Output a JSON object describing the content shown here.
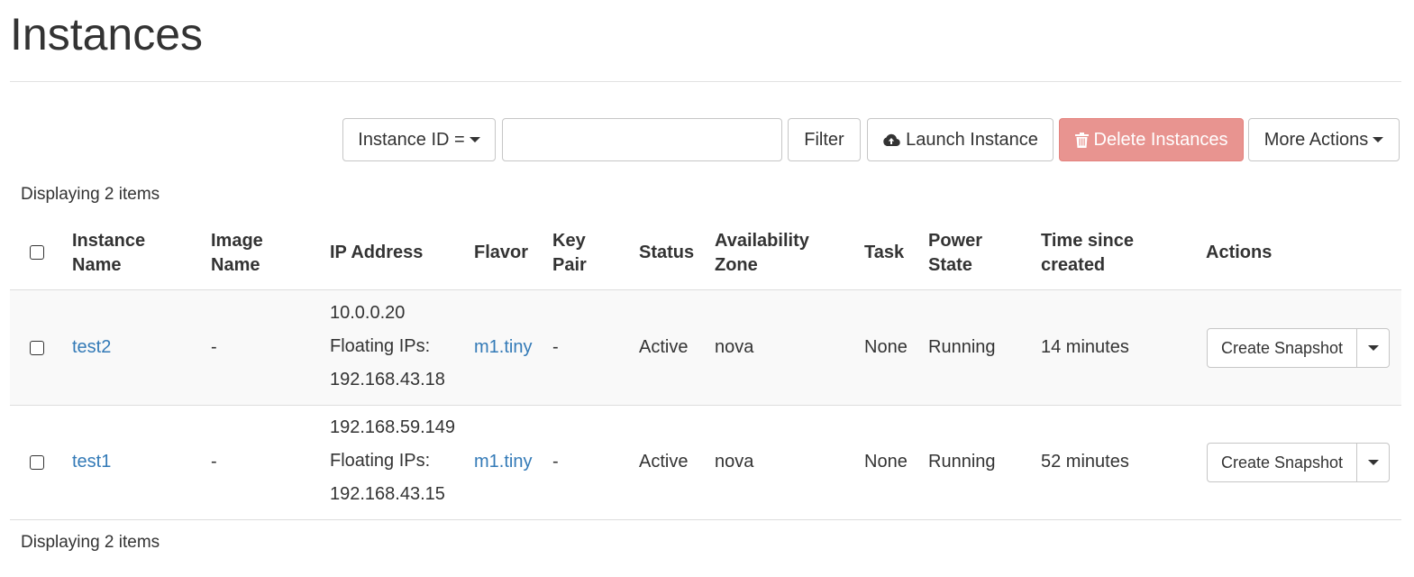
{
  "page": {
    "title": "Instances"
  },
  "toolbar": {
    "filter_field": "Instance ID =",
    "filter_value": "",
    "filter_label": "Filter",
    "launch_label": "Launch Instance",
    "delete_label": "Delete Instances",
    "more_label": "More Actions"
  },
  "summary": {
    "top": "Displaying 2 items",
    "bottom": "Displaying 2 items"
  },
  "table": {
    "headers": {
      "name": [
        "Instance",
        "Name"
      ],
      "image": [
        "Image",
        "Name"
      ],
      "ip": [
        "IP Address"
      ],
      "flavor": [
        "Flavor"
      ],
      "key": [
        "Key",
        "Pair"
      ],
      "status": [
        "Status"
      ],
      "zone": [
        "Availability",
        "Zone"
      ],
      "task": [
        "Task"
      ],
      "power": [
        "Power",
        "State"
      ],
      "time": [
        "Time since",
        "created"
      ],
      "actions": [
        "Actions"
      ]
    },
    "rows": [
      {
        "name": "test2",
        "image": "-",
        "ip": [
          "10.0.0.20",
          "Floating IPs:",
          "192.168.43.18"
        ],
        "flavor": "m1.tiny",
        "key_pair": "-",
        "status": "Active",
        "zone": "nova",
        "task": "None",
        "power_state": "Running",
        "age": "14 minutes",
        "action_label": "Create Snapshot"
      },
      {
        "name": "test1",
        "image": "-",
        "ip": [
          "192.168.59.149",
          "Floating IPs:",
          "192.168.43.15"
        ],
        "flavor": "m1.tiny",
        "key_pair": "-",
        "status": "Active",
        "zone": "nova",
        "task": "None",
        "power_state": "Running",
        "age": "52 minutes",
        "action_label": "Create Snapshot"
      }
    ]
  },
  "colors": {
    "link": "#337ab7",
    "danger_disabled": "#e89490",
    "row_stripe": "#f9f9f9"
  },
  "icons": {
    "launch": "cloud-upload-icon",
    "delete": "trash-icon"
  }
}
